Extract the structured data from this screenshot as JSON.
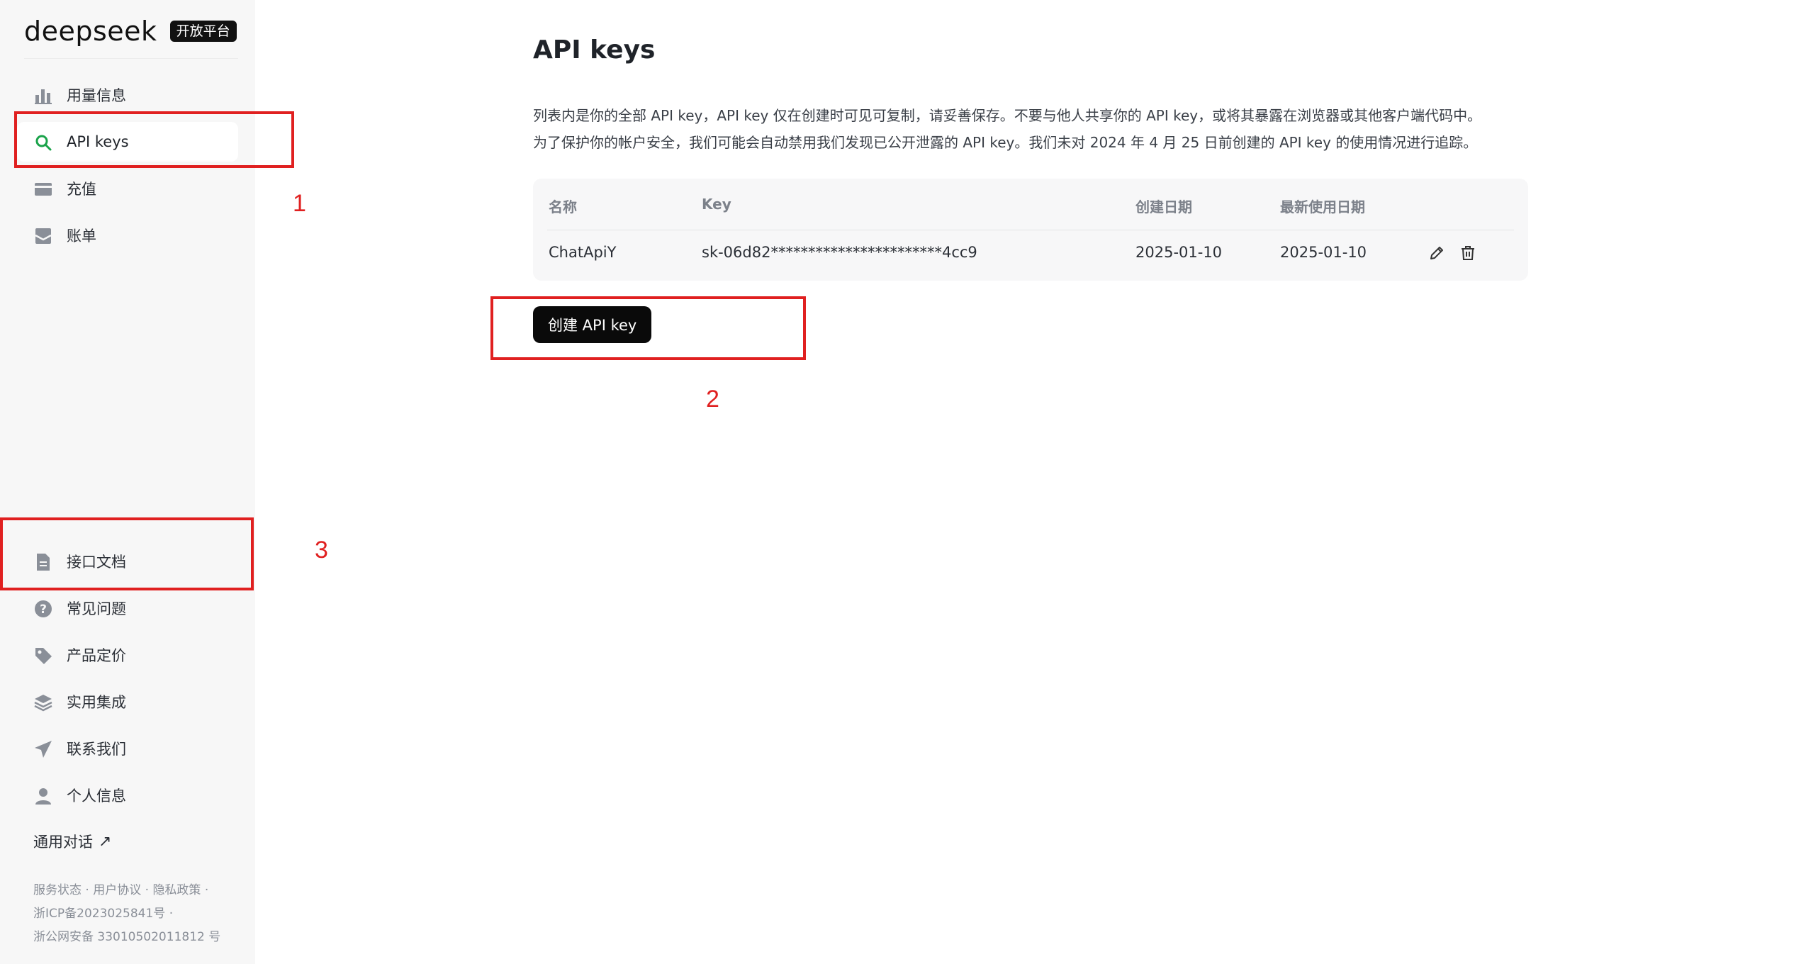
{
  "brand": {
    "logo_text": "deepseek",
    "badge": "开放平台"
  },
  "sidebar": {
    "top_items": [
      {
        "label": "用量信息",
        "icon": "bar-chart-icon"
      },
      {
        "label": "API keys",
        "icon": "search-key-icon",
        "active": true
      },
      {
        "label": "充值",
        "icon": "card-icon"
      },
      {
        "label": "账单",
        "icon": "inbox-icon"
      }
    ],
    "bottom_items": [
      {
        "label": "接口文档",
        "icon": "document-icon"
      },
      {
        "label": "常见问题",
        "icon": "question-icon"
      },
      {
        "label": "产品定价",
        "icon": "tag-icon"
      },
      {
        "label": "实用集成",
        "icon": "layers-icon"
      },
      {
        "label": "联系我们",
        "icon": "send-icon"
      },
      {
        "label": "个人信息",
        "icon": "user-icon"
      }
    ],
    "chat_link": "通用对话",
    "footer": {
      "service_status": "服务状态",
      "user_agreement": "用户协议",
      "privacy": "隐私政策",
      "icp": "浙ICP备2023025841号",
      "police": "浙公网安备 33010502011812 号"
    }
  },
  "main": {
    "title": "API keys",
    "desc_line1": "列表内是你的全部 API key，API key 仅在创建时可见可复制，请妥善保存。不要与他人共享你的 API key，或将其暴露在浏览器或其他客户端代码中。",
    "desc_line2": "为了保护你的帐户安全，我们可能会自动禁用我们发现已公开泄露的 API key。我们未对 2024 年 4 月 25 日前创建的 API key 的使用情况进行追踪。",
    "table": {
      "headers": {
        "name": "名称",
        "key": "Key",
        "created": "创建日期",
        "last_used": "最新使用日期"
      },
      "rows": [
        {
          "name": "ChatApiY",
          "key": "sk-06d82***********************4cc9",
          "created": "2025-01-10",
          "last_used": "2025-01-10"
        }
      ]
    },
    "create_button": "创建 API key"
  },
  "annotations": {
    "label_1": "1",
    "label_2": "2",
    "label_3": "3",
    "color": "#e02020"
  }
}
